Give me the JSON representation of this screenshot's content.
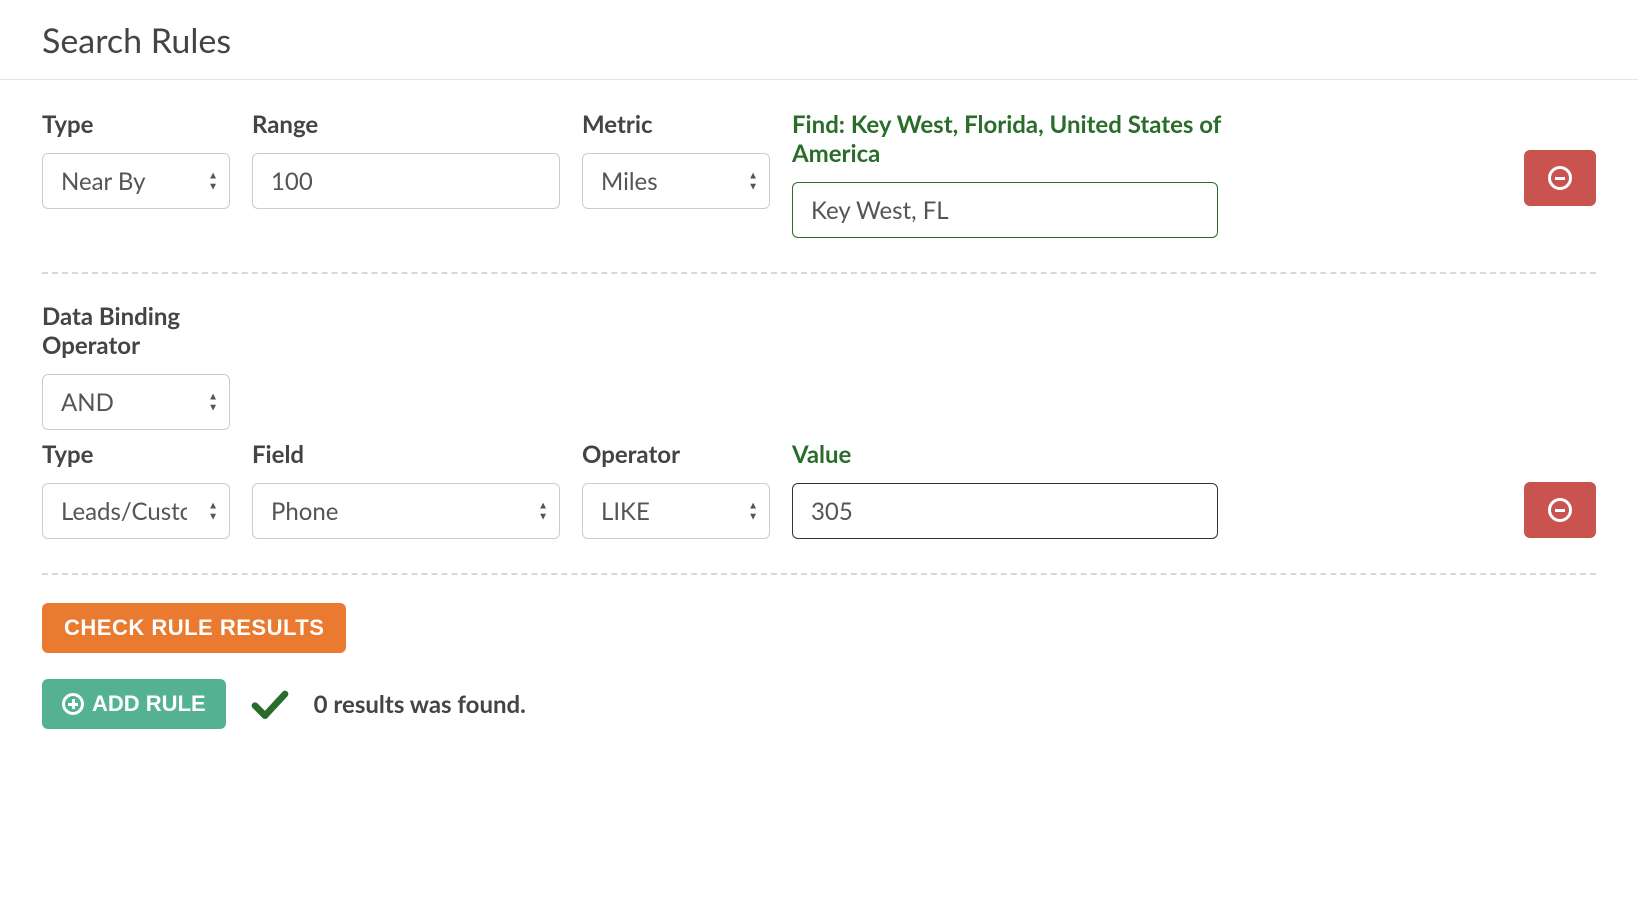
{
  "title": "Search Rules",
  "rule1": {
    "labels": {
      "type": "Type",
      "range": "Range",
      "metric": "Metric",
      "find": "Find: Key West, Florida, United States of America"
    },
    "type_value": "Near By",
    "range_value": "100",
    "metric_value": "Miles",
    "location_value": "Key West, FL"
  },
  "binding": {
    "label": "Data Binding Operator",
    "value": "AND"
  },
  "rule2": {
    "labels": {
      "type": "Type",
      "field": "Field",
      "operator": "Operator",
      "value": "Value"
    },
    "type_value": "Leads/Custom",
    "field_value": "Phone",
    "operator_value": "LIKE",
    "value_value": "305"
  },
  "buttons": {
    "check": "CHECK RULE RESULTS",
    "add": "ADD RULE"
  },
  "results_text": "0 results was found."
}
